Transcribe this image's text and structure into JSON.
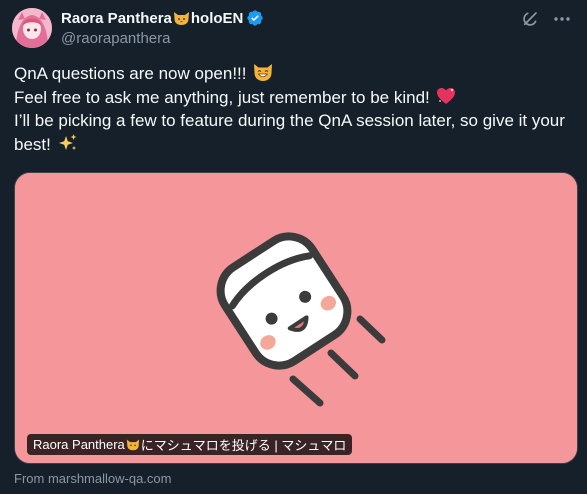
{
  "author": {
    "display_name_prefix": "Raora Panthera",
    "display_name_suffix": "holoEN",
    "handle": "@raorapanthera",
    "verified_color": "#1d9bf0",
    "avatar_icon": "avatar-image"
  },
  "tweet": {
    "line1": "QnA questions are now open!!! ",
    "line2": "Feel free to ask me anything, just remember to be kind! ",
    "line3": "I’ll be picking a few to feature during the QnA session later, so give it your best! "
  },
  "card": {
    "background": "#f4969a",
    "title_prefix": "Raora Panthera",
    "title_suffix": "にマシュマロを投げる | マシュマロ",
    "source": "From marshmallow-qa.com"
  },
  "icons": {
    "grok": "grok-icon",
    "more": "more-icon",
    "verified": "verified-badge-icon"
  }
}
